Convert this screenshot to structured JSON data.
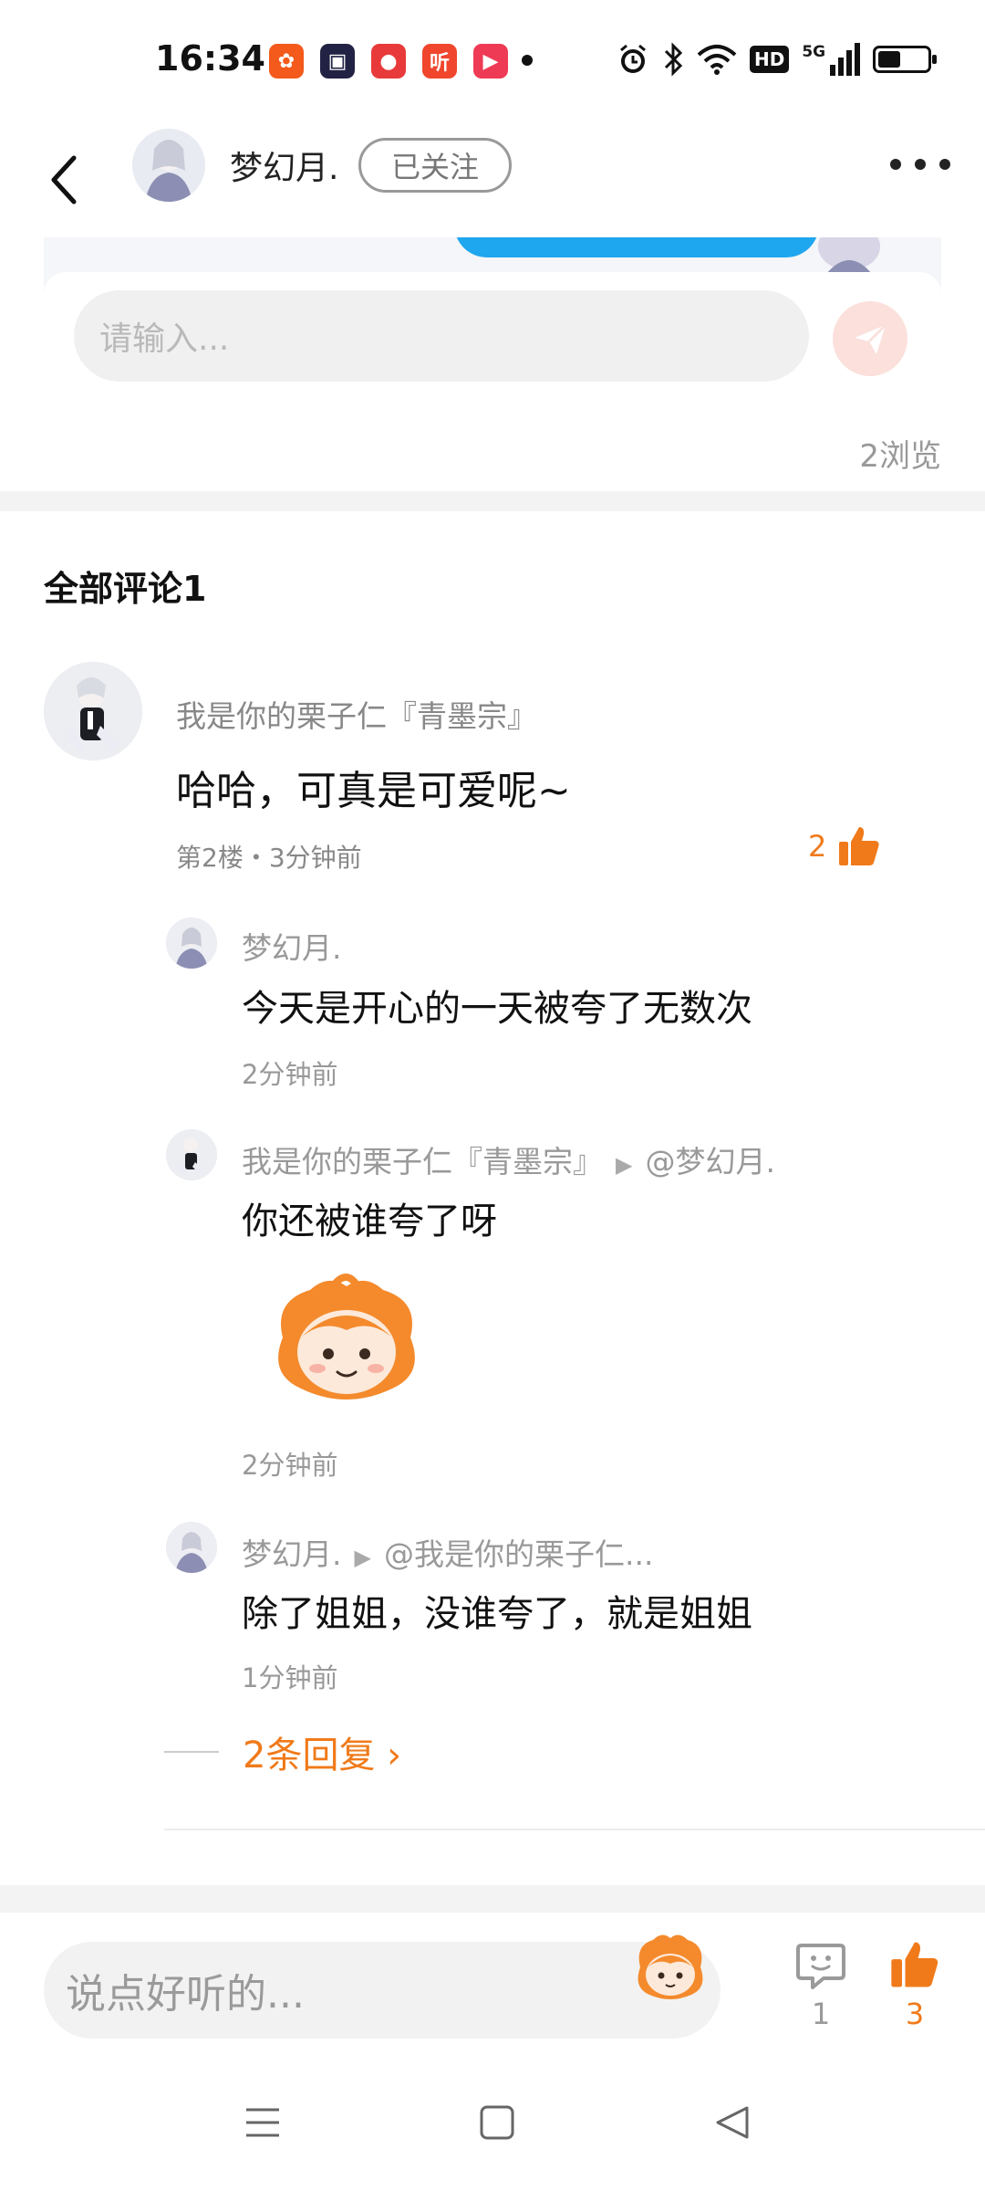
{
  "status_bar": {
    "time": "16:34",
    "app_icons": [
      {
        "name": "weibo-icon",
        "color": "#f35a1b",
        "glyph": "✿"
      },
      {
        "name": "bilibili-icon",
        "color": "#222244",
        "glyph": "▣"
      },
      {
        "name": "location-app-icon",
        "color": "#e83a3a",
        "glyph": "●"
      },
      {
        "name": "listen-app-icon",
        "color": "#f0462d",
        "glyph": "听"
      },
      {
        "name": "video-app-icon",
        "color": "#ef3a55",
        "glyph": "▶"
      }
    ],
    "network": "5G",
    "hd": "HD"
  },
  "header": {
    "username": "梦幻月.",
    "follow_label": "已关注"
  },
  "post": {
    "input_placeholder": "请输入...",
    "views": "2浏览"
  },
  "comments": {
    "title": "全部评论1",
    "top_comment": {
      "author": "我是你的栗子仁『青墨宗』",
      "text": "哈哈，可真是可爱呢~",
      "meta": "第2楼・3分钟前",
      "likes": "2"
    },
    "replies": [
      {
        "author": "梦幻月.",
        "target": "",
        "text": "今天是开心的一天被夸了无数次",
        "time": "2分钟前"
      },
      {
        "author": "我是你的栗子仁『青墨宗』",
        "target": "@梦幻月.",
        "text": "你还被谁夸了呀",
        "time": "2分钟前"
      },
      {
        "author": "梦幻月.",
        "target": "@我是你的栗子仁...",
        "text": "除了姐姐，没谁夸了，就是姐姐",
        "time": "1分钟前"
      }
    ],
    "more_replies": "2条回复 ›"
  },
  "bottom_bar": {
    "placeholder": "说点好听的...",
    "comment_count": "1",
    "like_count": "3"
  },
  "colors": {
    "accent": "#f07a1a",
    "comment_icon": "#9a9a9a"
  }
}
